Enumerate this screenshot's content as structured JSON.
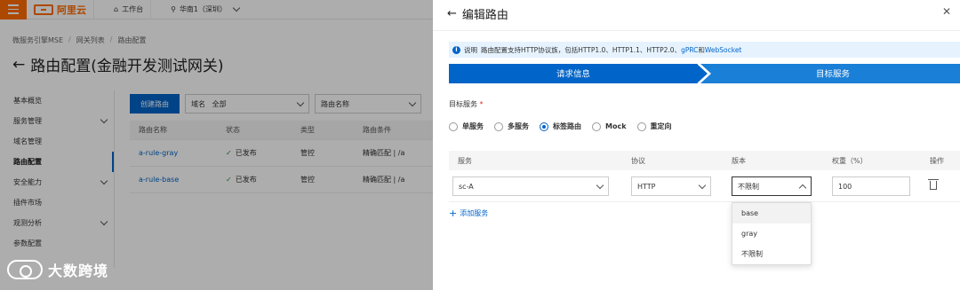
{
  "console": {
    "logo_text": "阿里云",
    "workbench": "工作台",
    "region": "华南1（深圳）",
    "breadcrumb": [
      "微服务引擎MSE",
      "网关列表",
      "路由配置"
    ],
    "title": "路由配置(金融开发测试网关)",
    "nav": [
      {
        "label": "基本概览",
        "expand": false
      },
      {
        "label": "服务管理",
        "expand": true
      },
      {
        "label": "域名管理",
        "expand": false
      },
      {
        "label": "路由配置",
        "expand": false,
        "active": true
      },
      {
        "label": "安全能力",
        "expand": true
      },
      {
        "label": "插件市场",
        "expand": false
      },
      {
        "label": "观测分析",
        "expand": true
      },
      {
        "label": "参数配置",
        "expand": false
      }
    ],
    "create_button": "创建路由",
    "domain_select": {
      "label": "域名",
      "value": "全部"
    },
    "route_name_select": {
      "label": "路由名称"
    },
    "table": {
      "headers": [
        "路由名称",
        "状态",
        "类型",
        "路由条件"
      ],
      "rows": [
        {
          "name": "a-rule-gray",
          "status": "已发布",
          "type": "管控",
          "condition": "精确匹配 | /a"
        },
        {
          "name": "a-rule-base",
          "status": "已发布",
          "type": "管控",
          "condition": "精确匹配 | /a"
        }
      ]
    }
  },
  "watermark": "大数跨境",
  "drawer": {
    "title": "编辑路由",
    "notice": {
      "prefix": "说明",
      "text": "路由配置支持HTTP协议族，包括HTTP1.0、HTTP1.1、HTTP2.0、",
      "link1": "gPRC",
      "and": "和",
      "link2": "WebSocket"
    },
    "steps": [
      "请求信息",
      "目标服务"
    ],
    "target_label": "目标服务",
    "required_mark": "*",
    "radios": [
      {
        "label": "单服务",
        "checked": false
      },
      {
        "label": "多服务",
        "checked": false
      },
      {
        "label": "标签路由",
        "checked": true
      },
      {
        "label": "Mock",
        "checked": false
      },
      {
        "label": "重定向",
        "checked": false
      }
    ],
    "columns": [
      "服务",
      "协议",
      "版本",
      "权重（%）",
      "操作"
    ],
    "row": {
      "service": "sc-A",
      "protocol": "HTTP",
      "version": "不限制",
      "weight": "100"
    },
    "add_service": "添加服务",
    "version_options": [
      "base",
      "gray",
      "不限制"
    ]
  },
  "colors": {
    "accent": "#0064c8",
    "brand": "#ff6a00",
    "step_active": "#0064c8",
    "step_pending": "#1a7fd6"
  }
}
